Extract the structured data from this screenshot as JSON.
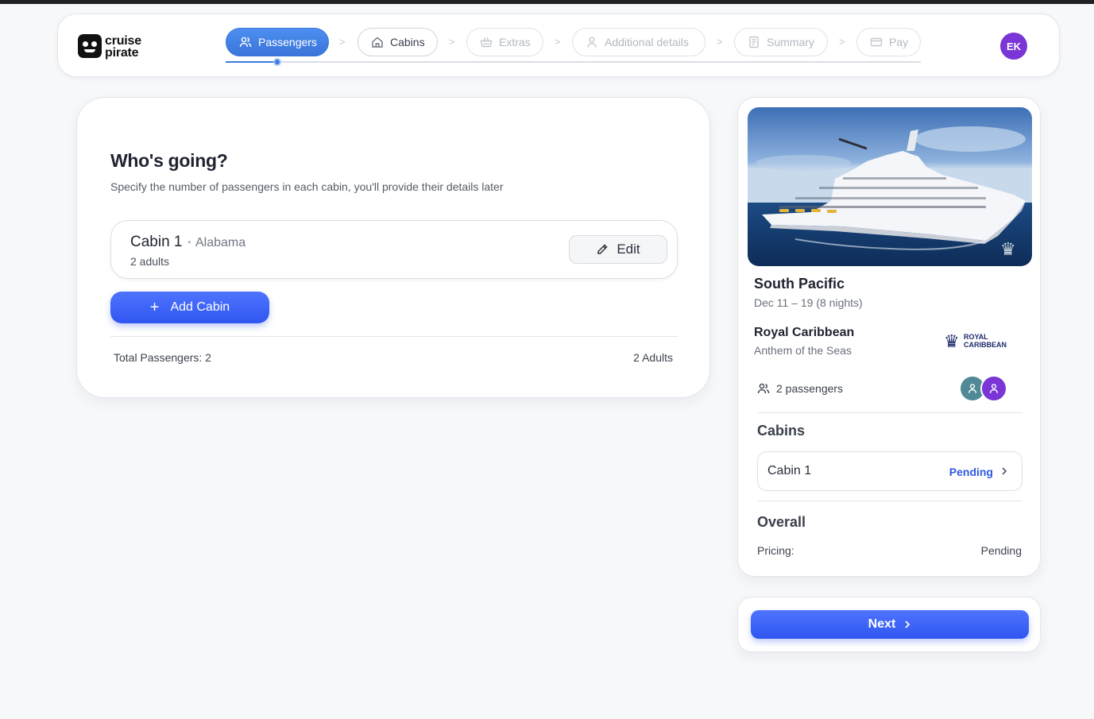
{
  "brand": {
    "line1": "cruise",
    "line2": "pirate"
  },
  "steps": [
    {
      "label": "Passengers",
      "icon": "users-icon",
      "state": "active"
    },
    {
      "label": "Cabins",
      "icon": "home-icon",
      "state": "available"
    },
    {
      "label": "Extras",
      "icon": "basket-icon",
      "state": "disabled"
    },
    {
      "label": "Additional details",
      "icon": "user-icon",
      "state": "disabled"
    },
    {
      "label": "Summary",
      "icon": "document-icon",
      "state": "disabled"
    },
    {
      "label": "Pay",
      "icon": "credit-card-icon",
      "state": "disabled"
    }
  ],
  "user": {
    "initials": "EK",
    "color": "#7a35d6"
  },
  "main": {
    "title": "Who's going?",
    "subtitle": "Specify the number of passengers in each cabin, you'll provide their details later",
    "cabin": {
      "name": "Cabin 1",
      "separator": "•",
      "location": "Alabama",
      "occupants": "2 adults",
      "edit_label": "Edit"
    },
    "add_cabin_label": "Add Cabin",
    "total_label": "Total Passengers: 2",
    "total_breakdown": "2 Adults"
  },
  "summary": {
    "destination": "South Pacific",
    "dates": "Dec 11 – 19  (8 nights)",
    "cruise_line": "Royal Caribbean",
    "ship": "Anthem of the Seas",
    "line_logo": {
      "line1": "ROYAL",
      "line2": "CARIBBEAN"
    },
    "passengers": "2 passengers",
    "cabins_heading": "Cabins",
    "cabins": [
      {
        "name": "Cabin 1",
        "status": "Pending"
      }
    ],
    "overall_heading": "Overall",
    "pricing_label": "Pricing:",
    "pricing_value": "Pending"
  },
  "next_label": "Next",
  "colors": {
    "accent": "#3059e0",
    "step_active": "#3b75d9",
    "pending": "#3059e0"
  }
}
